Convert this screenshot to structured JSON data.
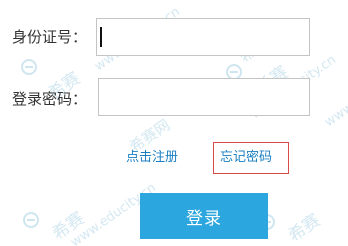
{
  "form": {
    "id_label": "身份证号：",
    "id_value": "",
    "password_label": "登录密码：",
    "password_value": ""
  },
  "links": {
    "register": "点击注册",
    "forgot_password": "忘记密码"
  },
  "login_button": "登录",
  "watermark": {
    "url": "www.educity.cn",
    "cn": "希赛网",
    "brand": "希赛"
  },
  "colors": {
    "link": "#1a7fc2",
    "button": "#2ba6de",
    "highlight_box": "#d64a4a"
  }
}
